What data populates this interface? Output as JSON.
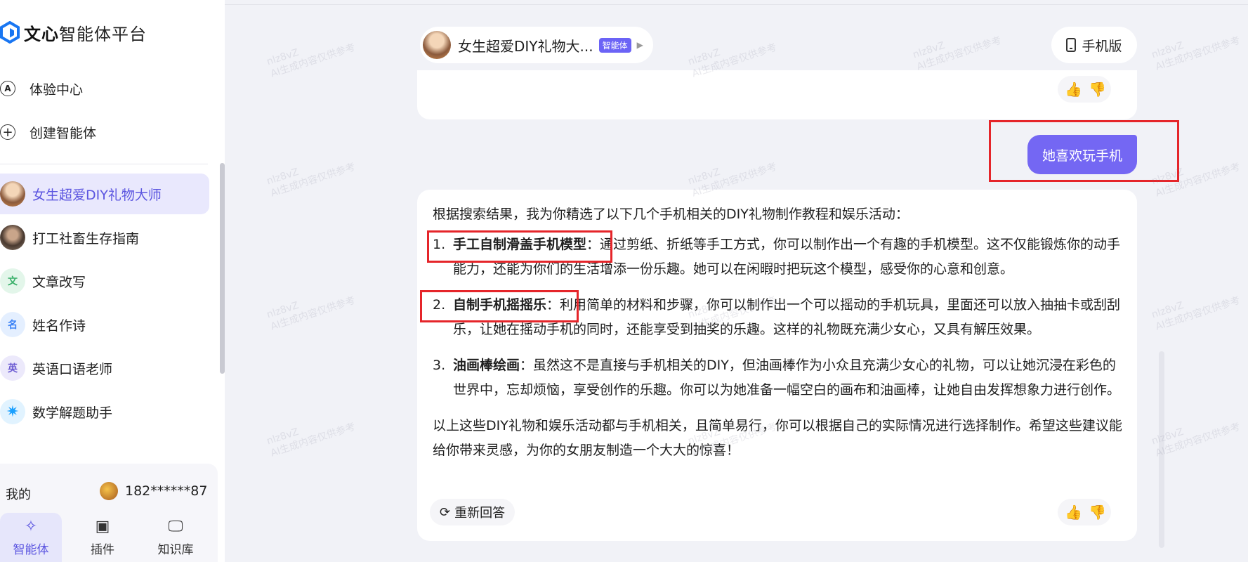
{
  "sidebar": {
    "logo_bold": "文心",
    "logo_light": "智能体平台",
    "nav": [
      {
        "icon": "experience-icon",
        "glyph": "A",
        "label": "体验中心"
      },
      {
        "icon": "plus-circle-icon",
        "glyph": "+",
        "label": "创建智能体"
      }
    ],
    "agents": [
      {
        "label": "女生超爱DIY礼物大师",
        "active": true
      },
      {
        "label": "打工社畜生存指南"
      },
      {
        "label": "文章改写",
        "glyph": "文",
        "color": "#3ab06a"
      },
      {
        "label": "姓名作诗",
        "glyph": "名",
        "color": "#3b82f6"
      },
      {
        "label": "英语口语老师",
        "glyph": "英",
        "color": "#6d5dd3"
      },
      {
        "label": "数学解题助手",
        "glyph": "✷",
        "color": "#1aa0ff"
      }
    ],
    "footer": {
      "me_label": "我的",
      "username": "182******87",
      "tabs": [
        {
          "icon": "sparkle-icon",
          "glyph": "✧",
          "label": "智能体",
          "active": true
        },
        {
          "icon": "plugin-icon",
          "glyph": "▣",
          "label": "插件"
        },
        {
          "icon": "knowledge-icon",
          "glyph": "🖵",
          "label": "知识库"
        }
      ]
    }
  },
  "header": {
    "agent_title": "女生超爱DIY礼物大...",
    "badge": "智能体",
    "mobile_label": "手机版"
  },
  "chat": {
    "user_message": "她喜欢玩手机",
    "answer": {
      "intro": "根据搜索结果，我为你精选了以下几个手机相关的DIY礼物制作教程和娱乐活动：",
      "items": [
        {
          "num": "1.",
          "title": "手工自制滑盖手机模型",
          "text": "：通过剪纸、折纸等手工方式，你可以制作出一个有趣的手机模型。这不仅能锻炼你的动手能力，还能为你们的生活增添一份乐趣。她可以在闲暇时把玩这个模型，感受你的心意和创意。"
        },
        {
          "num": "2.",
          "title": "自制手机摇摇乐",
          "text": "：利用简单的材料和步骤，你可以制作出一个可以摇动的手机玩具，里面还可以放入抽抽卡或刮刮乐，让她在摇动手机的同时，还能享受到抽奖的乐趣。这样的礼物既充满少女心，又具有解压效果。"
        },
        {
          "num": "3.",
          "title": "油画棒绘画",
          "text": "：虽然这不是直接与手机相关的DIY，但油画棒作为小众且充满少女心的礼物，可以让她沉浸在彩色的世界中，忘却烦恼，享受创作的乐趣。你可以为她准备一幅空白的画布和油画棒，让她自由发挥想象力进行创作。"
        }
      ],
      "conclusion": "以上这些DIY礼物和娱乐活动都与手机相关，且简单易行，你可以根据自己的实际情况进行选择制作。希望这些建议能给你带来灵感，为你的女朋友制造一个大大的惊喜！",
      "regenerate_label": "重新回答"
    }
  },
  "colors": {
    "accent": "#7467f3",
    "active_bg": "#e9e8fd",
    "highlight_box": "#e5252a"
  }
}
